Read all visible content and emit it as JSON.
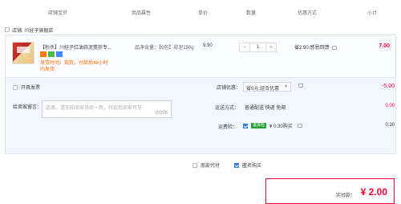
{
  "columns": [
    {
      "key": "store_info",
      "label": "店铺宝贝"
    },
    {
      "key": "attrs",
      "label": "商品属性"
    },
    {
      "key": "price",
      "label": "单价"
    },
    {
      "key": "qty",
      "label": "数量"
    },
    {
      "key": "promo",
      "label": "优惠方式"
    },
    {
      "key": "subtotal",
      "label": "小计"
    }
  ],
  "store": {
    "label": "店铺: 川娃子旗舰店"
  },
  "item": {
    "title": "【秒杀】川娃子红油蒜泥搅拌专...",
    "spec": "品净含量：【5包】蒜泥150g",
    "price": "9.90",
    "qty": "1",
    "note1": "发货时间：现货，付款后48小时",
    "note2": "内发货",
    "promo": "省2.90:感恩回馈",
    "subtotal": "7.00",
    "colors": {
      "accent": "#ff0036",
      "badge_orange": "#ff7a00",
      "badge_green": "#4fb84a",
      "badge_blue": "#3f8cff"
    }
  },
  "options": {
    "invoice_label": "开具发票",
    "message_label": "给卖家留言：",
    "message_placeholder": "选填，请先和商家协商一致，付款后商家可见",
    "message_count": "0/200",
    "coupon_label": "店铺优惠：",
    "coupon_value": "省5元:组合优惠",
    "coupon_discount": "-5.00",
    "delivery_label": "运送方式：",
    "delivery_value": "普通配送 快递 免邮",
    "delivery_fee": "0.00",
    "insurance_label": "运费险：",
    "insurance_badge": "退货险",
    "insurance_value": "¥ 0.30购买",
    "insurance_fee": "0.30"
  },
  "footer": {
    "friend_pay": "朋友代付",
    "anonymous": "匿名购买",
    "pay_label": "实付款：",
    "pay_amount": "¥ 2.00"
  }
}
